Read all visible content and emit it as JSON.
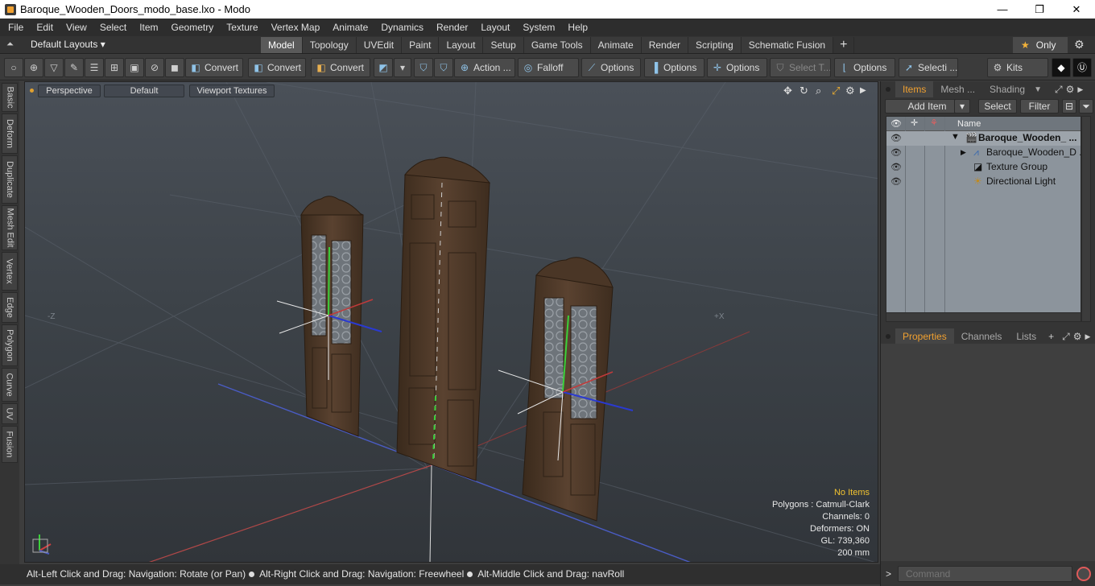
{
  "window": {
    "title": "Baroque_Wooden_Doors_modo_base.lxo - Modo",
    "minimize": "—",
    "maximize": "❐",
    "close": "✕"
  },
  "menu": [
    "File",
    "Edit",
    "View",
    "Select",
    "Item",
    "Geometry",
    "Texture",
    "Vertex Map",
    "Animate",
    "Dynamics",
    "Render",
    "Layout",
    "System",
    "Help"
  ],
  "layoutbar": {
    "layouts_label": "Default Layouts ▾",
    "tabs": [
      "Model",
      "Topology",
      "UVEdit",
      "Paint",
      "Layout",
      "Setup",
      "Game Tools",
      "Animate",
      "Render",
      "Scripting",
      "Schematic Fusion"
    ],
    "active_tab": "Model",
    "plus": "+",
    "only_label": "Only"
  },
  "toolbar": {
    "convert_1": "Convert",
    "convert_2": "Convert",
    "convert_3": "Convert",
    "action": "Action ...",
    "falloff": "Falloff",
    "options_1": "Options",
    "options_2": "Options",
    "options_3": "Options",
    "select_t": "Select T...",
    "options_4": "Options",
    "selecti": "Selecti ...",
    "kits": "Kits"
  },
  "left_tabs": [
    "Basic",
    "Deform",
    "Duplicate",
    "Mesh Edit",
    "Vertex",
    "Edge",
    "Polygon",
    "Curve",
    "UV",
    "Fusion"
  ],
  "viewport": {
    "view_mode": "Perspective",
    "shading": "Default",
    "textures": "Viewport Textures",
    "axis_minus_z": "-Z",
    "axis_plus_x": "+X",
    "info": {
      "no_items": "No Items",
      "polygons": "Polygons : Catmull-Clark",
      "channels": "Channels: 0",
      "deformers": "Deformers: ON",
      "gl": "GL: 739,360",
      "scale": "200 mm"
    }
  },
  "status": {
    "hint_1": "Alt-Left Click and Drag: Navigation: Rotate (or Pan)",
    "hint_2": "Alt-Right Click and Drag: Navigation: Freewheel",
    "hint_3": "Alt-Middle Click and Drag: navRoll"
  },
  "items_panel": {
    "tabs": [
      "Items",
      "Mesh ...",
      "Shading"
    ],
    "active_tab": "Items",
    "add_item": "Add Item",
    "select": "Select",
    "filter": "Filter",
    "column_name": "Name",
    "rows": [
      {
        "label": "Baroque_Wooden_ ...",
        "indent": 0
      },
      {
        "label": "Baroque_Wooden_D ...",
        "indent": 1
      },
      {
        "label": "Texture Group",
        "indent": 1
      },
      {
        "label": "Directional Light",
        "indent": 1
      }
    ]
  },
  "props_panel": {
    "tabs": [
      "Properties",
      "Channels",
      "Lists"
    ],
    "active_tab": "Properties"
  },
  "command": {
    "placeholder": "Command"
  },
  "colors": {
    "accent": "#f0a030",
    "viewport_top": "#4a5058",
    "viewport_bottom": "#31353a",
    "door_wood": "#4e3826"
  }
}
